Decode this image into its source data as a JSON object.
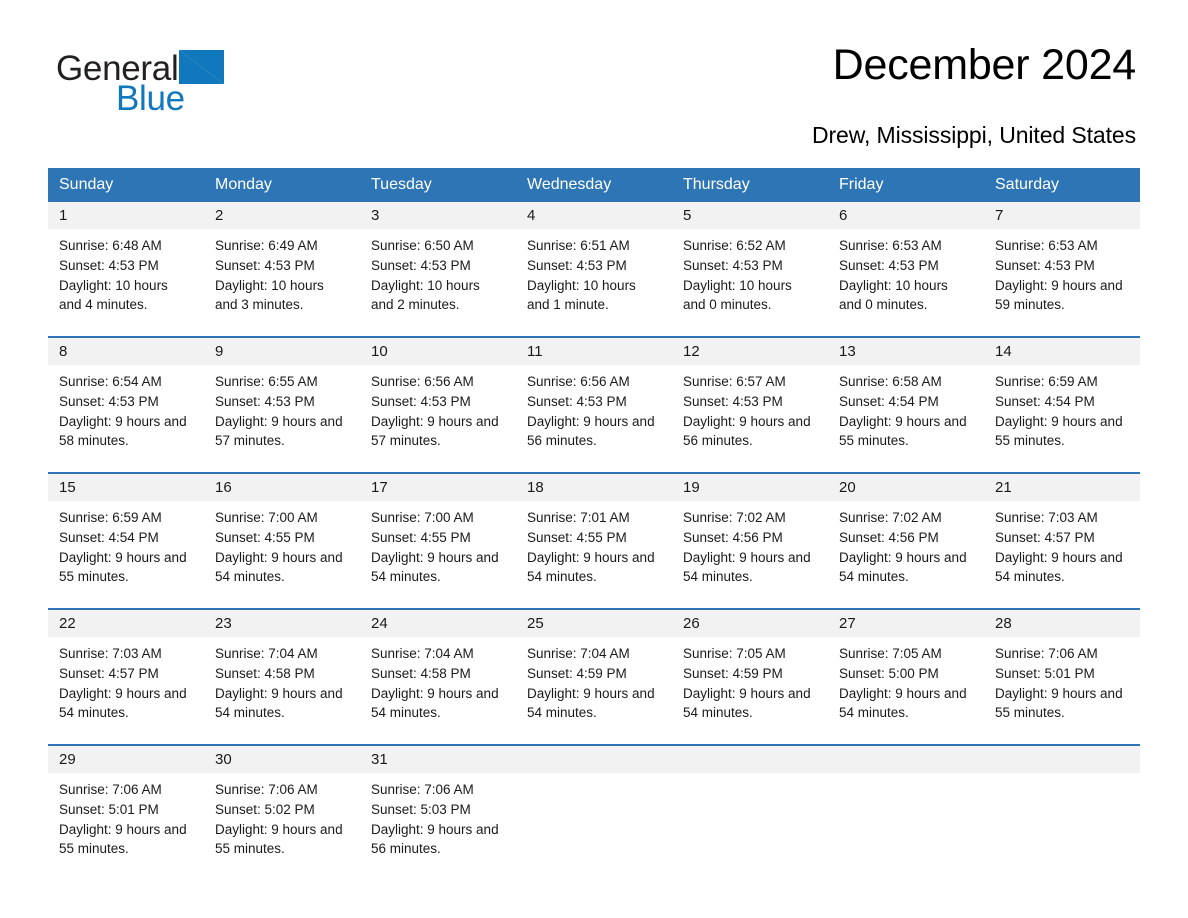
{
  "brand": {
    "name_part1": "General",
    "name_part2": "Blue",
    "triangle_color": "#1278be",
    "logo_icon": "general-blue-triangle-logo"
  },
  "header": {
    "title": "December 2024",
    "subtitle": "Drew, Mississippi, United States"
  },
  "theme": {
    "header_blue": "#2e75b6",
    "daynum_bg": "#f2f2f2",
    "text": "#1a1a1a",
    "brand_blue": "#1278be"
  },
  "weekday_headers": [
    "Sunday",
    "Monday",
    "Tuesday",
    "Wednesday",
    "Thursday",
    "Friday",
    "Saturday"
  ],
  "weeks": [
    [
      {
        "day": "1",
        "sunrise": "Sunrise: 6:48 AM",
        "sunset": "Sunset: 4:53 PM",
        "daylight": "Daylight: 10 hours and 4 minutes."
      },
      {
        "day": "2",
        "sunrise": "Sunrise: 6:49 AM",
        "sunset": "Sunset: 4:53 PM",
        "daylight": "Daylight: 10 hours and 3 minutes."
      },
      {
        "day": "3",
        "sunrise": "Sunrise: 6:50 AM",
        "sunset": "Sunset: 4:53 PM",
        "daylight": "Daylight: 10 hours and 2 minutes."
      },
      {
        "day": "4",
        "sunrise": "Sunrise: 6:51 AM",
        "sunset": "Sunset: 4:53 PM",
        "daylight": "Daylight: 10 hours and 1 minute."
      },
      {
        "day": "5",
        "sunrise": "Sunrise: 6:52 AM",
        "sunset": "Sunset: 4:53 PM",
        "daylight": "Daylight: 10 hours and 0 minutes."
      },
      {
        "day": "6",
        "sunrise": "Sunrise: 6:53 AM",
        "sunset": "Sunset: 4:53 PM",
        "daylight": "Daylight: 10 hours and 0 minutes."
      },
      {
        "day": "7",
        "sunrise": "Sunrise: 6:53 AM",
        "sunset": "Sunset: 4:53 PM",
        "daylight": "Daylight: 9 hours and 59 minutes."
      }
    ],
    [
      {
        "day": "8",
        "sunrise": "Sunrise: 6:54 AM",
        "sunset": "Sunset: 4:53 PM",
        "daylight": "Daylight: 9 hours and 58 minutes."
      },
      {
        "day": "9",
        "sunrise": "Sunrise: 6:55 AM",
        "sunset": "Sunset: 4:53 PM",
        "daylight": "Daylight: 9 hours and 57 minutes."
      },
      {
        "day": "10",
        "sunrise": "Sunrise: 6:56 AM",
        "sunset": "Sunset: 4:53 PM",
        "daylight": "Daylight: 9 hours and 57 minutes."
      },
      {
        "day": "11",
        "sunrise": "Sunrise: 6:56 AM",
        "sunset": "Sunset: 4:53 PM",
        "daylight": "Daylight: 9 hours and 56 minutes."
      },
      {
        "day": "12",
        "sunrise": "Sunrise: 6:57 AM",
        "sunset": "Sunset: 4:53 PM",
        "daylight": "Daylight: 9 hours and 56 minutes."
      },
      {
        "day": "13",
        "sunrise": "Sunrise: 6:58 AM",
        "sunset": "Sunset: 4:54 PM",
        "daylight": "Daylight: 9 hours and 55 minutes."
      },
      {
        "day": "14",
        "sunrise": "Sunrise: 6:59 AM",
        "sunset": "Sunset: 4:54 PM",
        "daylight": "Daylight: 9 hours and 55 minutes."
      }
    ],
    [
      {
        "day": "15",
        "sunrise": "Sunrise: 6:59 AM",
        "sunset": "Sunset: 4:54 PM",
        "daylight": "Daylight: 9 hours and 55 minutes."
      },
      {
        "day": "16",
        "sunrise": "Sunrise: 7:00 AM",
        "sunset": "Sunset: 4:55 PM",
        "daylight": "Daylight: 9 hours and 54 minutes."
      },
      {
        "day": "17",
        "sunrise": "Sunrise: 7:00 AM",
        "sunset": "Sunset: 4:55 PM",
        "daylight": "Daylight: 9 hours and 54 minutes."
      },
      {
        "day": "18",
        "sunrise": "Sunrise: 7:01 AM",
        "sunset": "Sunset: 4:55 PM",
        "daylight": "Daylight: 9 hours and 54 minutes."
      },
      {
        "day": "19",
        "sunrise": "Sunrise: 7:02 AM",
        "sunset": "Sunset: 4:56 PM",
        "daylight": "Daylight: 9 hours and 54 minutes."
      },
      {
        "day": "20",
        "sunrise": "Sunrise: 7:02 AM",
        "sunset": "Sunset: 4:56 PM",
        "daylight": "Daylight: 9 hours and 54 minutes."
      },
      {
        "day": "21",
        "sunrise": "Sunrise: 7:03 AM",
        "sunset": "Sunset: 4:57 PM",
        "daylight": "Daylight: 9 hours and 54 minutes."
      }
    ],
    [
      {
        "day": "22",
        "sunrise": "Sunrise: 7:03 AM",
        "sunset": "Sunset: 4:57 PM",
        "daylight": "Daylight: 9 hours and 54 minutes."
      },
      {
        "day": "23",
        "sunrise": "Sunrise: 7:04 AM",
        "sunset": "Sunset: 4:58 PM",
        "daylight": "Daylight: 9 hours and 54 minutes."
      },
      {
        "day": "24",
        "sunrise": "Sunrise: 7:04 AM",
        "sunset": "Sunset: 4:58 PM",
        "daylight": "Daylight: 9 hours and 54 minutes."
      },
      {
        "day": "25",
        "sunrise": "Sunrise: 7:04 AM",
        "sunset": "Sunset: 4:59 PM",
        "daylight": "Daylight: 9 hours and 54 minutes."
      },
      {
        "day": "26",
        "sunrise": "Sunrise: 7:05 AM",
        "sunset": "Sunset: 4:59 PM",
        "daylight": "Daylight: 9 hours and 54 minutes."
      },
      {
        "day": "27",
        "sunrise": "Sunrise: 7:05 AM",
        "sunset": "Sunset: 5:00 PM",
        "daylight": "Daylight: 9 hours and 54 minutes."
      },
      {
        "day": "28",
        "sunrise": "Sunrise: 7:06 AM",
        "sunset": "Sunset: 5:01 PM",
        "daylight": "Daylight: 9 hours and 55 minutes."
      }
    ],
    [
      {
        "day": "29",
        "sunrise": "Sunrise: 7:06 AM",
        "sunset": "Sunset: 5:01 PM",
        "daylight": "Daylight: 9 hours and 55 minutes."
      },
      {
        "day": "30",
        "sunrise": "Sunrise: 7:06 AM",
        "sunset": "Sunset: 5:02 PM",
        "daylight": "Daylight: 9 hours and 55 minutes."
      },
      {
        "day": "31",
        "sunrise": "Sunrise: 7:06 AM",
        "sunset": "Sunset: 5:03 PM",
        "daylight": "Daylight: 9 hours and 56 minutes."
      },
      {
        "day": "",
        "sunrise": "",
        "sunset": "",
        "daylight": ""
      },
      {
        "day": "",
        "sunrise": "",
        "sunset": "",
        "daylight": ""
      },
      {
        "day": "",
        "sunrise": "",
        "sunset": "",
        "daylight": ""
      },
      {
        "day": "",
        "sunrise": "",
        "sunset": "",
        "daylight": ""
      }
    ]
  ]
}
